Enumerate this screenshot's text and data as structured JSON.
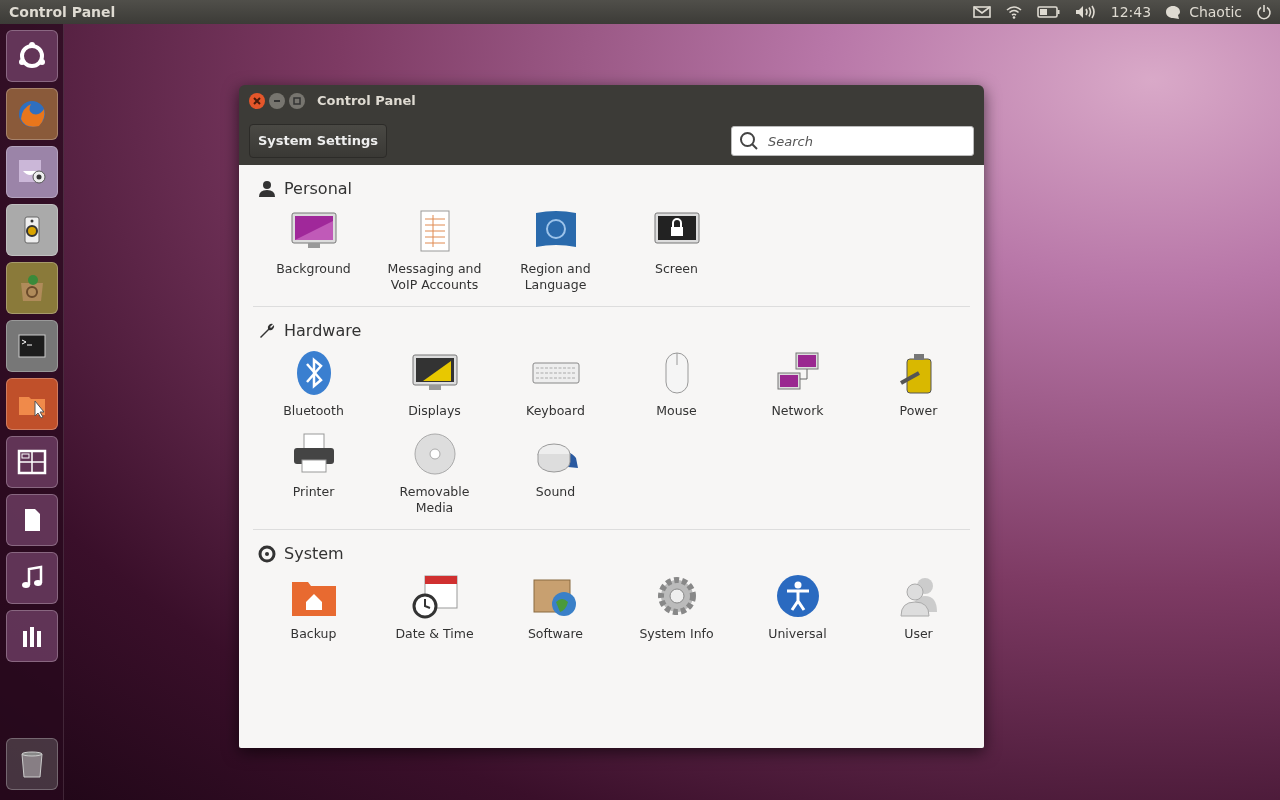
{
  "top_panel": {
    "title": "Control Panel",
    "clock": "12:43",
    "user": "Chaotic"
  },
  "window": {
    "title": "Control Panel",
    "breadcrumb": "System Settings",
    "search": {
      "placeholder": "Search"
    },
    "sections": [
      {
        "title": "Personal",
        "items": [
          {
            "label": "Background"
          },
          {
            "label": "Messaging and VoIP Accounts"
          },
          {
            "label": "Region and Language"
          },
          {
            "label": "Screen"
          }
        ]
      },
      {
        "title": "Hardware",
        "items": [
          {
            "label": "Bluetooth"
          },
          {
            "label": "Displays"
          },
          {
            "label": "Keyboard"
          },
          {
            "label": "Mouse"
          },
          {
            "label": "Network"
          },
          {
            "label": "Power"
          },
          {
            "label": "Printer"
          },
          {
            "label": "Removable Media"
          },
          {
            "label": "Sound"
          }
        ]
      },
      {
        "title": "System",
        "items": [
          {
            "label": "Backup"
          },
          {
            "label": "Date & Time"
          },
          {
            "label": "Software"
          },
          {
            "label": "System Info"
          },
          {
            "label": "Universal"
          },
          {
            "label": "User"
          }
        ]
      }
    ]
  }
}
